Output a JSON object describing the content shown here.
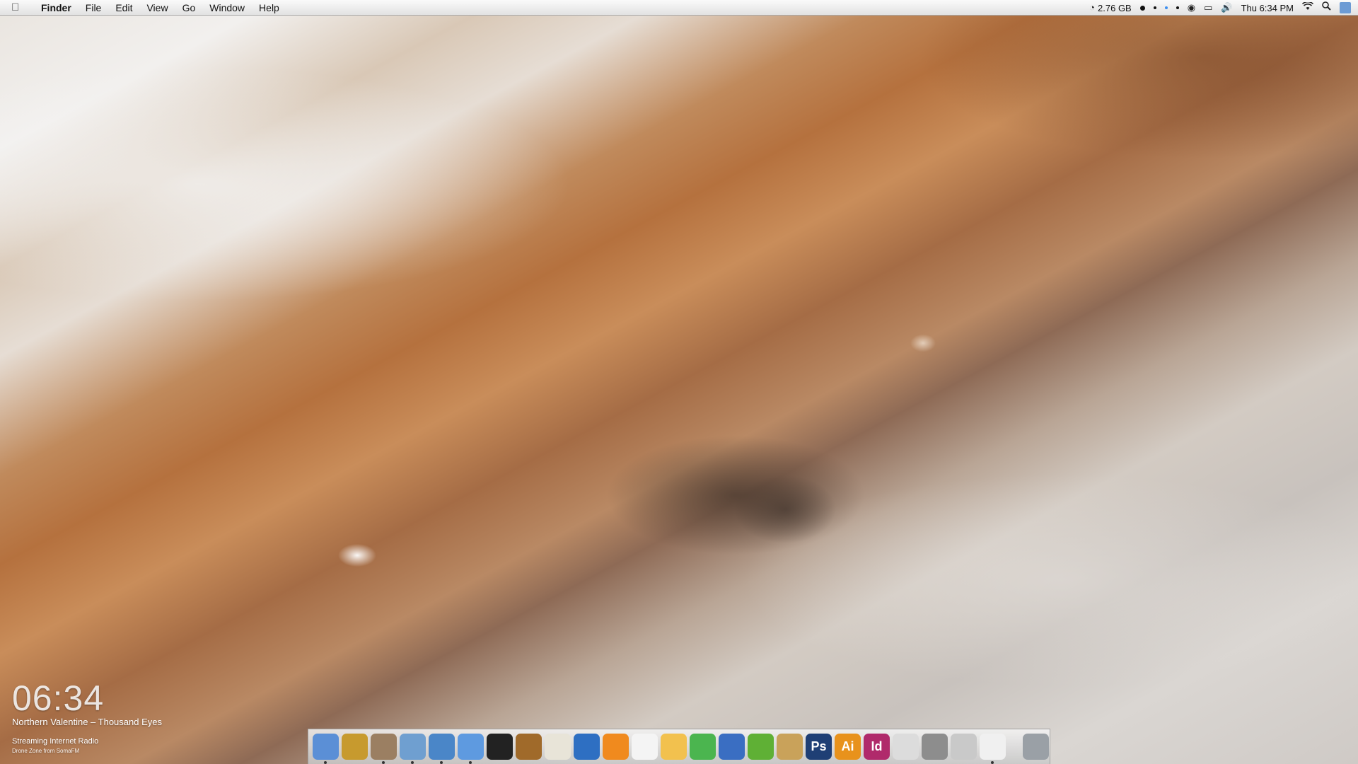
{
  "menubar": {
    "app_name": "Finder",
    "items": [
      "File",
      "Edit",
      "View",
      "Go",
      "Window",
      "Help"
    ],
    "memory": "2.76 GB",
    "datetime": "Thu 6:34 PM"
  },
  "widget": {
    "clock": "06:34",
    "track": "Northern Valentine – Thousand Eyes",
    "station": "Streaming Internet Radio",
    "substation": "Drone Zone from SomaFM"
  },
  "dock": {
    "apps": [
      {
        "icon": "finder-icon",
        "color": "#5b8fd6",
        "running": true
      },
      {
        "icon": "archive-box-icon",
        "color": "#c79a2e",
        "running": false
      },
      {
        "icon": "jupiter-icon",
        "color": "#9b7f62",
        "running": true
      },
      {
        "icon": "preview-icon",
        "color": "#6f9fd0",
        "running": true
      },
      {
        "icon": "safari-icon",
        "color": "#4a86c8",
        "running": true
      },
      {
        "icon": "itunes-icon",
        "color": "#5e9ae0",
        "running": true
      },
      {
        "icon": "dvd-player-icon",
        "color": "#222222",
        "running": false
      },
      {
        "icon": "garageband-icon",
        "color": "#a06a2a",
        "running": false
      },
      {
        "icon": "mu-icon",
        "color": "#e8e4d8",
        "running": false
      },
      {
        "icon": "feather-icon",
        "color": "#2e6fc2",
        "running": false
      },
      {
        "icon": "vlc-icon",
        "color": "#f08a1e",
        "running": false
      },
      {
        "icon": "textedit-icon",
        "color": "#f4f4f4",
        "running": false
      },
      {
        "icon": "pages-icon",
        "color": "#f2c14e",
        "running": false
      },
      {
        "icon": "numbers-icon",
        "color": "#4bb54f",
        "running": false
      },
      {
        "icon": "word-icon",
        "color": "#3a6ec2",
        "running": false
      },
      {
        "icon": "grapher-icon",
        "color": "#5fb035",
        "running": false
      },
      {
        "icon": "script-editor-icon",
        "color": "#c9a25a",
        "running": false
      },
      {
        "icon": "photoshop-icon",
        "color": "#1f3f75",
        "label": "Ps",
        "running": false
      },
      {
        "icon": "illustrator-icon",
        "color": "#e8921c",
        "label": "Ai",
        "running": false
      },
      {
        "icon": "indesign-icon",
        "color": "#b02a6b",
        "label": "Id",
        "running": false
      },
      {
        "icon": "system-info-icon",
        "color": "#dcdcdc",
        "running": false
      },
      {
        "icon": "disk-utility-icon",
        "color": "#8d8d8d",
        "running": false
      },
      {
        "icon": "calculator-icon",
        "color": "#c9c9c9",
        "running": false
      },
      {
        "icon": "clock-icon",
        "color": "#f0f0f0",
        "running": true
      }
    ],
    "trash": {
      "icon": "trash-icon",
      "color": "#9aa0a6"
    }
  }
}
